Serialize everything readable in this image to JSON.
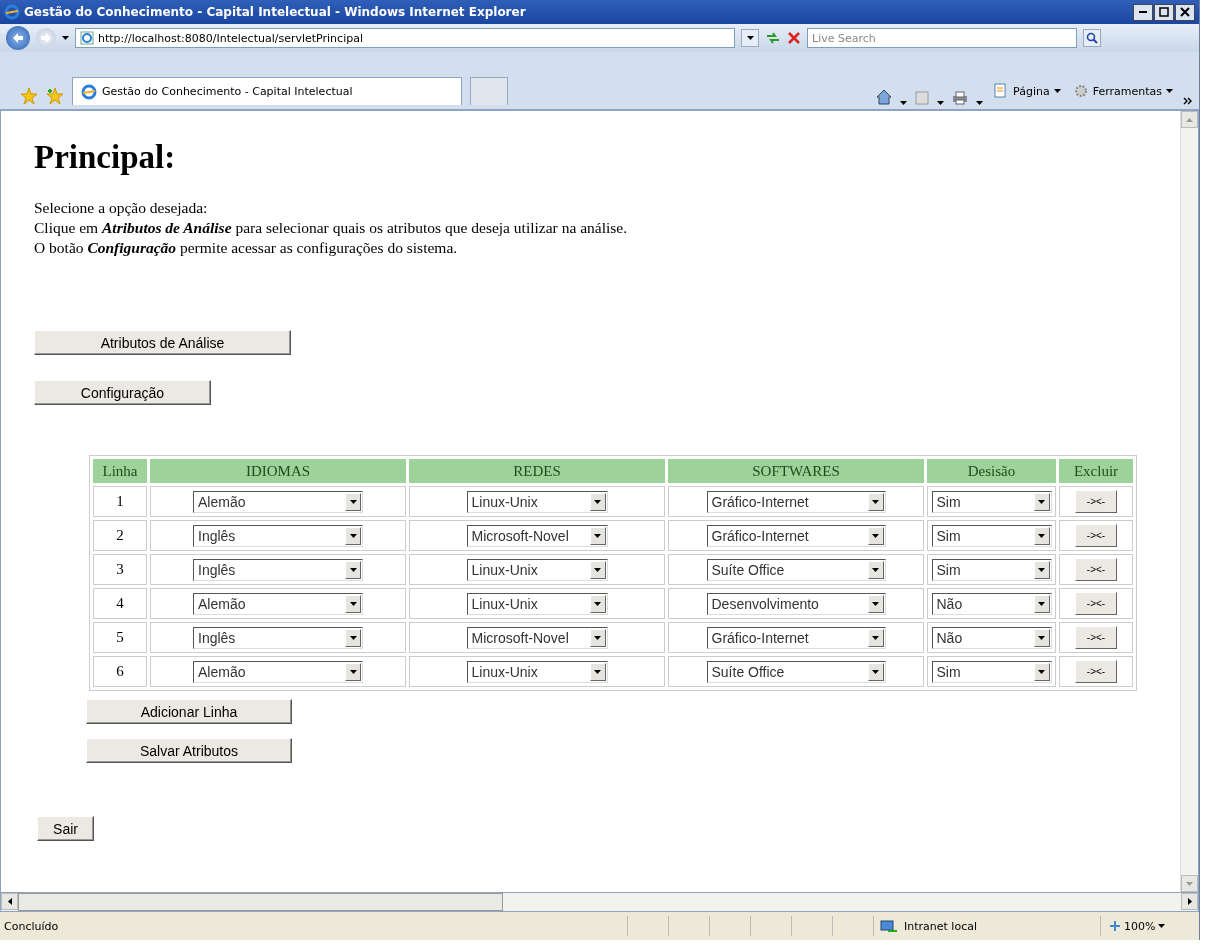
{
  "window": {
    "title": "Gestão do Conhecimento - Capital Intelectual - Windows Internet Explorer"
  },
  "address_bar": {
    "url": "http://localhost:8080/Intelectual/servletPrincipal",
    "search_placeholder": "Live Search"
  },
  "tabs": [
    {
      "label": "Gestão do Conhecimento - Capital Intelectual",
      "selected": true
    }
  ],
  "command_bar": [
    "Página",
    "Ferramentas"
  ],
  "page": {
    "heading": "Principal:",
    "lines": [
      "Selecione a opção desejada:",
      "Clique em **Atributos de Análise** para selecionar quais os atributos que deseja utilizar na análise.",
      "O botão **Configuração** permite acessar as configurações do sistema."
    ],
    "buttons": [
      "Atributos de Análise",
      "Configuração"
    ],
    "table": {
      "columns": [
        "Linha",
        "IDIOMAS",
        "REDES",
        "SOFTWARES",
        "Desisão",
        "Excluir"
      ],
      "rows": [
        {
          "linha": "1",
          "idioma": "Alemão",
          "rede": "Linux-Unix",
          "software": "Gráfico-Internet",
          "decisao": "Sim",
          "excluir": "-><-"
        },
        {
          "linha": "2",
          "idioma": "Inglês",
          "rede": "Microsoft-Novel",
          "software": "Gráfico-Internet",
          "decisao": "Sim",
          "excluir": "-><-"
        },
        {
          "linha": "3",
          "idioma": "Inglês",
          "rede": "Linux-Unix",
          "software": "Suíte Office",
          "decisao": "Sim",
          "excluir": "-><-"
        },
        {
          "linha": "4",
          "idioma": "Alemão",
          "rede": "Linux-Unix",
          "software": "Desenvolvimento",
          "decisao": "Não",
          "excluir": "-><-"
        },
        {
          "linha": "5",
          "idioma": "Inglês",
          "rede": "Microsoft-Novel",
          "software": "Gráfico-Internet",
          "decisao": "Não",
          "excluir": "-><-"
        },
        {
          "linha": "6",
          "idioma": "Alemão",
          "rede": "Linux-Unix",
          "software": "Suíte Office",
          "decisao": "Sim",
          "excluir": "-><-"
        }
      ]
    },
    "table_buttons": [
      "Adicionar Linha",
      "Salvar Atributos"
    ],
    "exit_button": "Sair"
  },
  "status_bar": {
    "text": "Concluído",
    "zone": "Intranet local",
    "zoom": "100%"
  }
}
